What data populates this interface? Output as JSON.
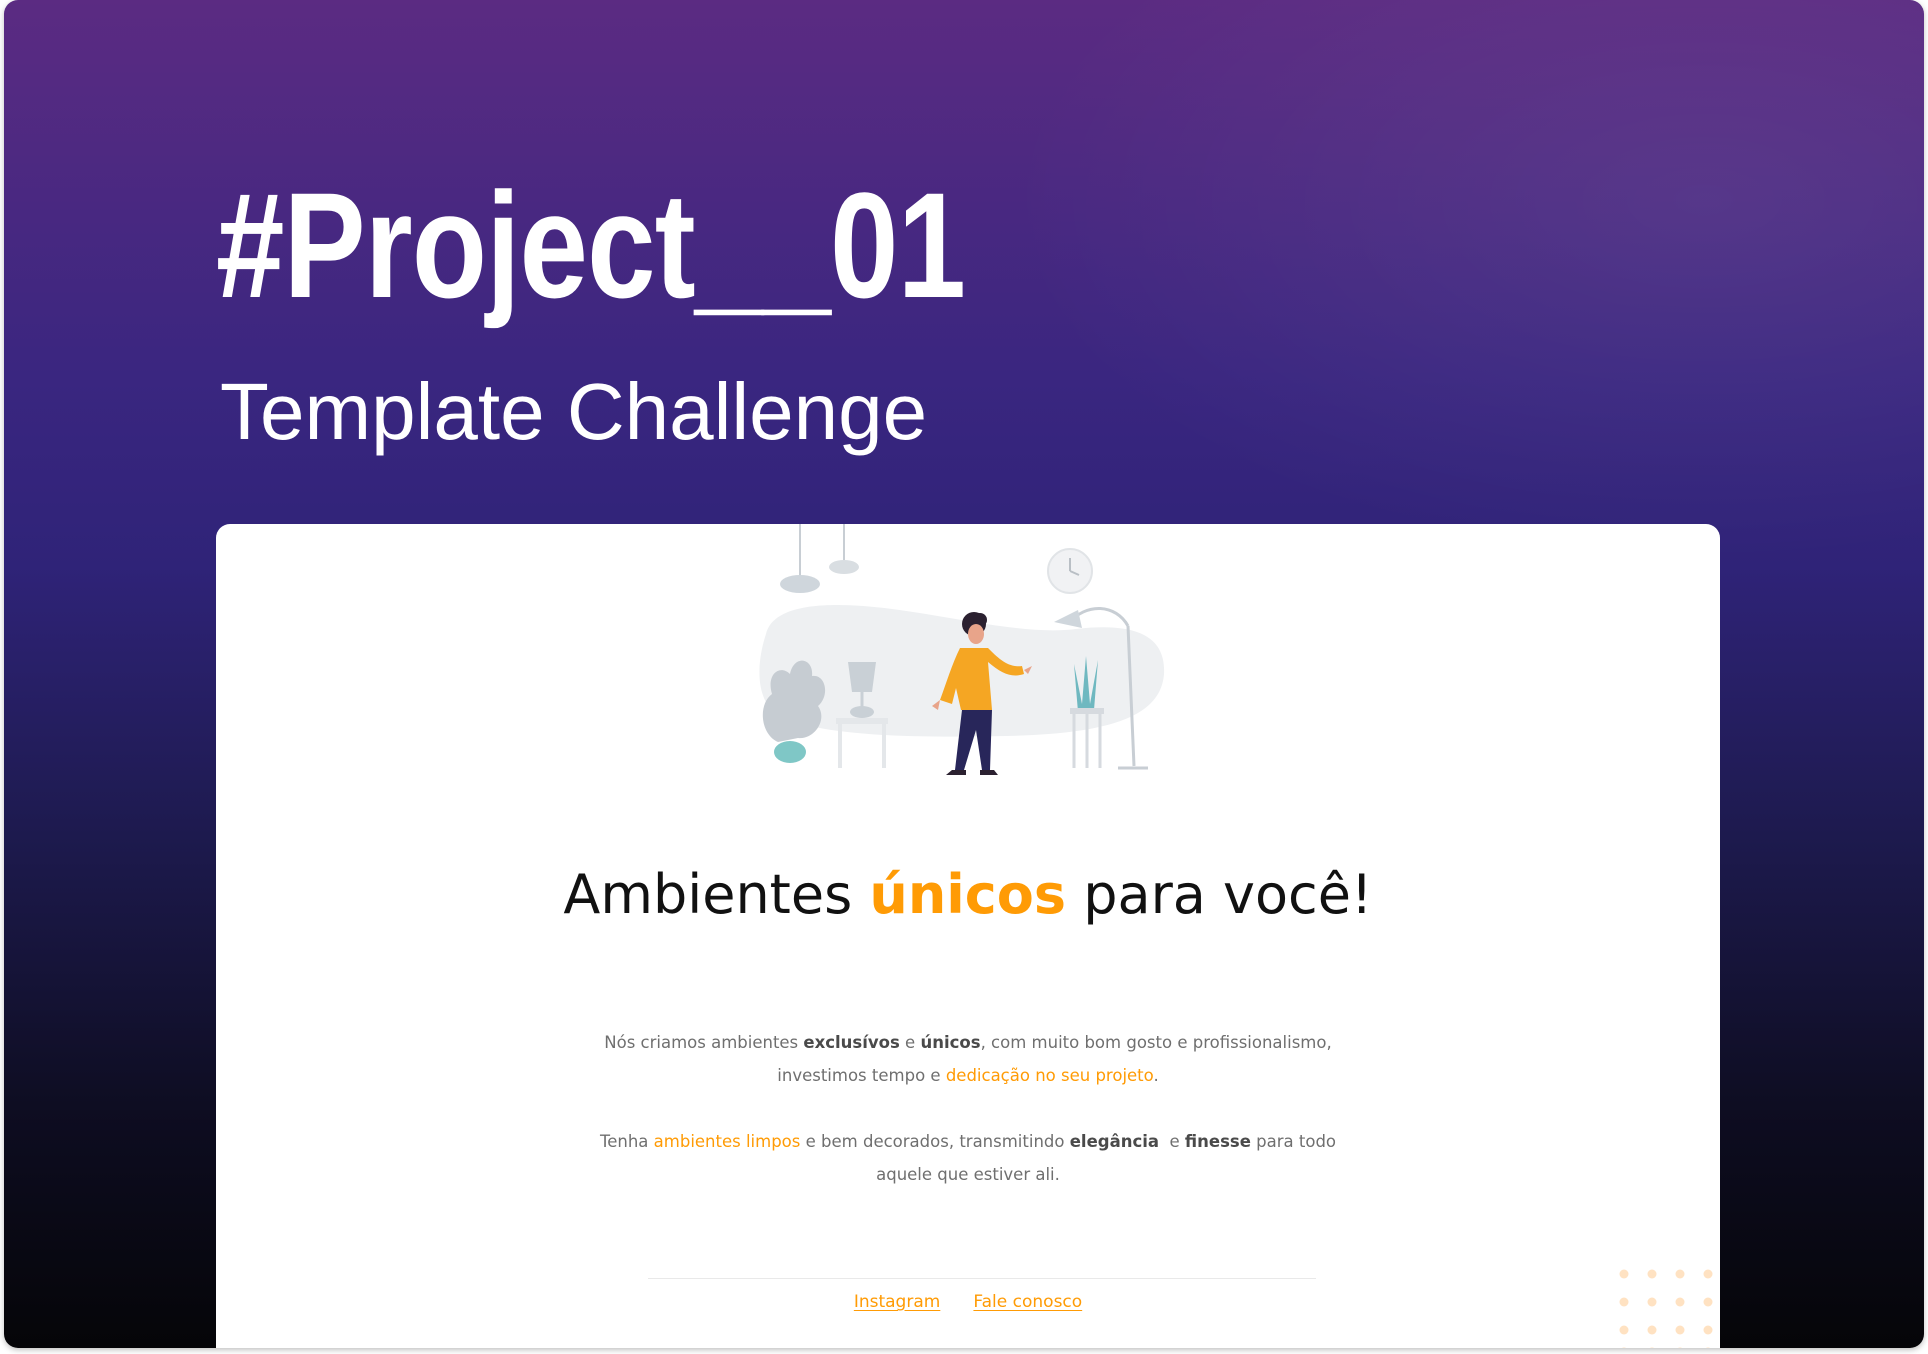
{
  "hero": {
    "title": "#Project__01",
    "subtitle": "Template Challenge"
  },
  "preview": {
    "illustration": "person-in-living-room-illustration",
    "headline": {
      "before": "Ambientes ",
      "accent": "únicos",
      "after": " para você!"
    },
    "paragraph1": {
      "t1": "Nós criamos ambientes ",
      "b1": "exclusívos",
      "t2": " e ",
      "b2": "únicos",
      "t3": ", com muito bom gosto e profissionalismo, investimos tempo e ",
      "hl1": "dedicação no seu projeto",
      "t4": "."
    },
    "paragraph2": {
      "t1": "Tenha ",
      "hl1": "ambientes limpos",
      "t2": " e bem decorados, transmitindo ",
      "b1": "elegância",
      "t3": "  e ",
      "b2": "finesse",
      "t4": " para todo aquele que estiver ali."
    },
    "footer": {
      "links": [
        "Instagram",
        "Fale conosco"
      ]
    }
  },
  "colors": {
    "accent": "#ff9b05",
    "background_top": "#5b2b82",
    "background_bottom": "#050508",
    "text_dark": "#111111",
    "text_muted": "#6f6f6f"
  }
}
